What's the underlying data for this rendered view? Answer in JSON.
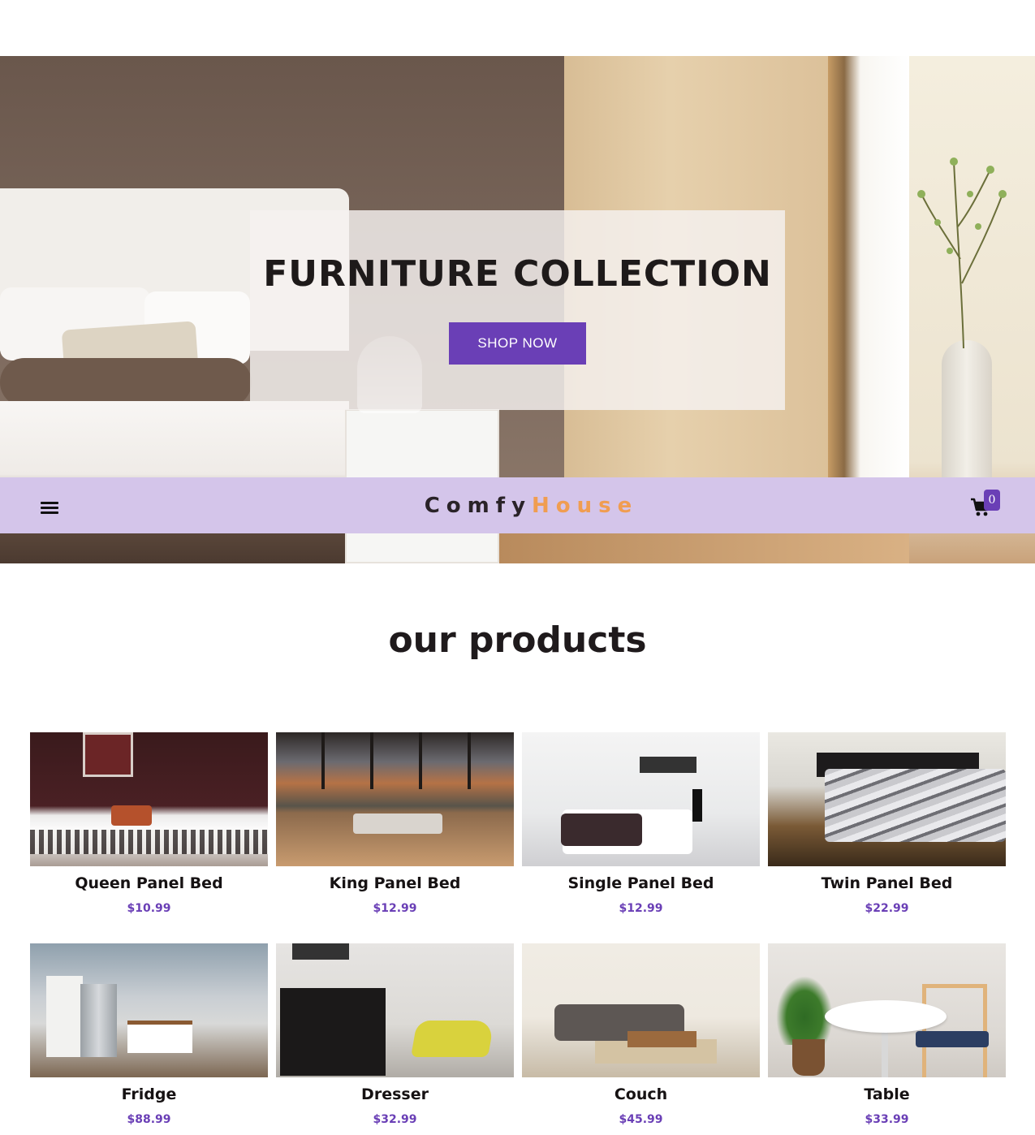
{
  "hero": {
    "title": "FURNITURE COLLECTION",
    "cta_label": "SHOP NOW"
  },
  "navbar": {
    "menu_icon": "hamburger-menu-icon",
    "logo_part1": "Comfy",
    "logo_part2": "House",
    "cart_icon": "shopping-cart-icon",
    "cart_count": "0"
  },
  "products": {
    "title": "our products",
    "items": [
      {
        "name": "Queen Panel Bed",
        "price": "$10.99"
      },
      {
        "name": "King Panel Bed",
        "price": "$12.99"
      },
      {
        "name": "Single Panel Bed",
        "price": "$12.99"
      },
      {
        "name": "Twin Panel Bed",
        "price": "$22.99"
      },
      {
        "name": "Fridge",
        "price": "$88.99"
      },
      {
        "name": "Dresser",
        "price": "$32.99"
      },
      {
        "name": "Couch",
        "price": "$45.99"
      },
      {
        "name": "Table",
        "price": "$33.99"
      }
    ]
  },
  "colors": {
    "accent": "#6a3fb6",
    "navbar_bg": "#d4c5ea",
    "logo_highlight": "#f09d51"
  }
}
